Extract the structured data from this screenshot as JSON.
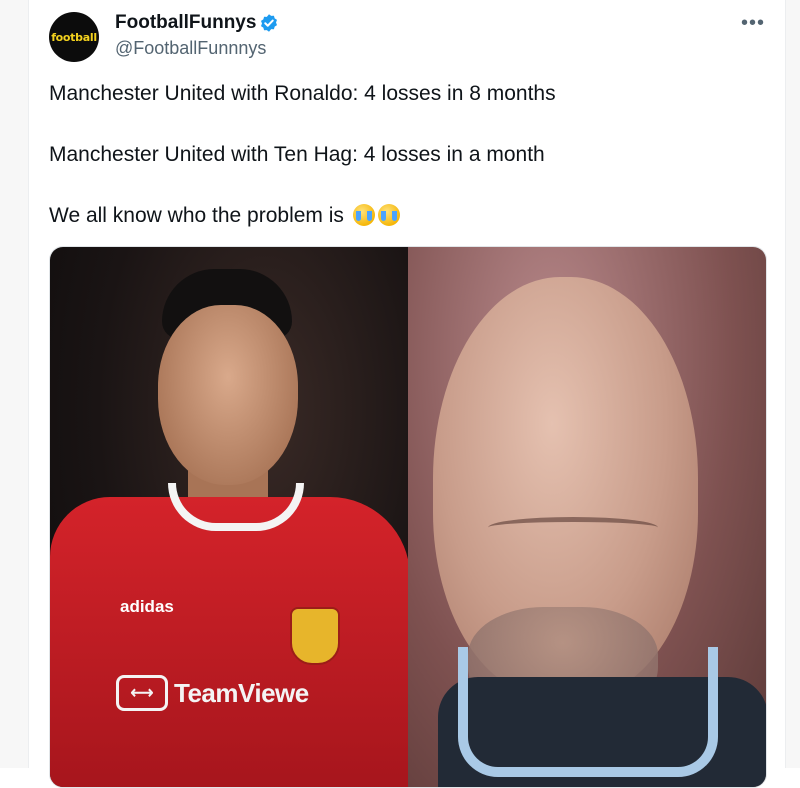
{
  "tweet": {
    "author": {
      "display_name": "FootballFunnys",
      "handle": "@FootballFunnnys",
      "avatar_logo_text": "football",
      "verified": true
    },
    "more_icon": "more-horizontal-icon",
    "lines": [
      "Manchester United with Ronaldo: 4 losses in 8 months",
      "Manchester United with Ten Hag: 4 losses in a month",
      "We all know who the problem is"
    ],
    "emoji": "loudly-crying-face",
    "media": {
      "left": {
        "shirt_brand": "adidas",
        "sponsor": "TeamViewer",
        "sponsor_visible": "TeamViewe"
      },
      "right": {}
    }
  },
  "colors": {
    "text": "#0f1419",
    "secondary": "#536471",
    "verified": "#1d9bf0"
  }
}
